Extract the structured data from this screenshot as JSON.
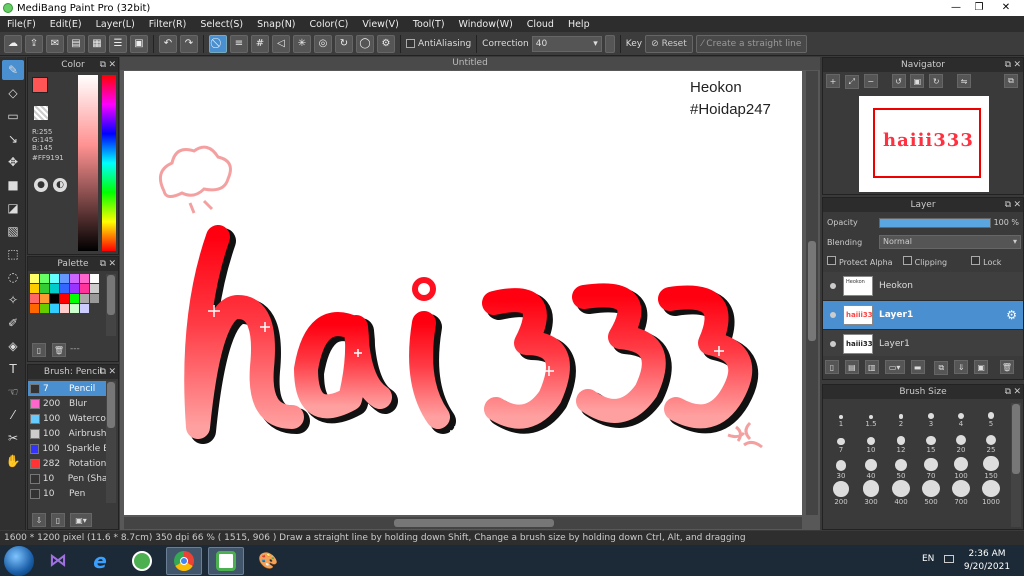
{
  "app": {
    "title": "MediBang Paint Pro (32bit)"
  },
  "menu": [
    "File(F)",
    "Edit(E)",
    "Layer(L)",
    "Filter(R)",
    "Select(S)",
    "Snap(N)",
    "Color(C)",
    "View(V)",
    "Tool(T)",
    "Window(W)",
    "Cloud",
    "Help"
  ],
  "toolbar": {
    "antialiasing_label": "AntiAliasing",
    "correction_label": "Correction",
    "correction_value": "40",
    "key_label": "Key",
    "reset_label": "Reset",
    "straight_line_label": "Create a straight line"
  },
  "color_panel": {
    "title": "Color",
    "r": "R:255",
    "g": "G:145",
    "b": "B:145",
    "hex": "#FF9191",
    "primary_color": "#ff5555",
    "secondary_color": "#ff9900"
  },
  "palette_panel": {
    "title": "Palette",
    "extra_label": "---",
    "swatches": [
      "#ffff66",
      "#66ff66",
      "#66ffff",
      "#6699ff",
      "#cc66ff",
      "#ff66cc",
      "#ffffff",
      "#ffcc00",
      "#33cc33",
      "#00cccc",
      "#3366ff",
      "#9933ff",
      "#ff3399",
      "#cccccc",
      "#ff6666",
      "#ff9933",
      "#000000",
      "#ff0000",
      "#00ff00",
      "#aaaaaa",
      "#999999",
      "#ff6600",
      "#66cc00",
      "#33ccff",
      "#ffcccc",
      "#ccffcc",
      "#ccccff"
    ]
  },
  "brush_panel": {
    "title": "Brush: Pencil",
    "items": [
      {
        "size": "7",
        "name": "Pencil",
        "color": "#333333"
      },
      {
        "size": "200",
        "name": "Blur",
        "color": "#ff66cc"
      },
      {
        "size": "100",
        "name": "Waterco",
        "color": "#66ccff"
      },
      {
        "size": "100",
        "name": "Airbrush",
        "color": "#cccccc"
      },
      {
        "size": "100",
        "name": "Sparkle B",
        "color": "#3333ff"
      },
      {
        "size": "282",
        "name": "Rotation",
        "color": "#ff3333"
      },
      {
        "size": "10",
        "name": "Pen (Sha",
        "color": "#333333"
      },
      {
        "size": "10",
        "name": "Pen",
        "color": "#333333"
      }
    ]
  },
  "document": {
    "tab_title": "Untitled",
    "signature_name": "Heokon",
    "signature_tag": "#Hoidap247",
    "artwork_text": "haiii333"
  },
  "navigator_panel": {
    "title": "Navigator"
  },
  "layer_panel": {
    "title": "Layer",
    "opacity_label": "Opacity",
    "opacity_value": "100 %",
    "opacity_fraction": 1.0,
    "blending_label": "Blending",
    "blending_value": "Normal",
    "protect_alpha_label": "Protect Alpha",
    "clipping_label": "Clipping",
    "lock_label": "Lock",
    "layers": [
      {
        "name": "Heokon",
        "selected": false
      },
      {
        "name": "Layer1",
        "selected": true
      },
      {
        "name": "Layer1",
        "selected": false
      }
    ]
  },
  "brush_size_panel": {
    "title": "Brush Size",
    "sizes": [
      "1",
      "1.5",
      "2",
      "3",
      "4",
      "5",
      "7",
      "10",
      "12",
      "15",
      "20",
      "25",
      "30",
      "40",
      "50",
      "70",
      "100",
      "150",
      "200",
      "300",
      "400",
      "500",
      "700",
      "1000"
    ]
  },
  "status": {
    "text": "1600 * 1200 pixel  (11.6 * 8.7cm)  350 dpi  66 %  ( 1515, 906 )  Draw a straight line by holding down Shift, Change a brush size by holding down Ctrl, Alt, and dragging"
  },
  "taskbar": {
    "lang": "EN",
    "time": "2:36 AM",
    "date": "9/20/2021"
  }
}
